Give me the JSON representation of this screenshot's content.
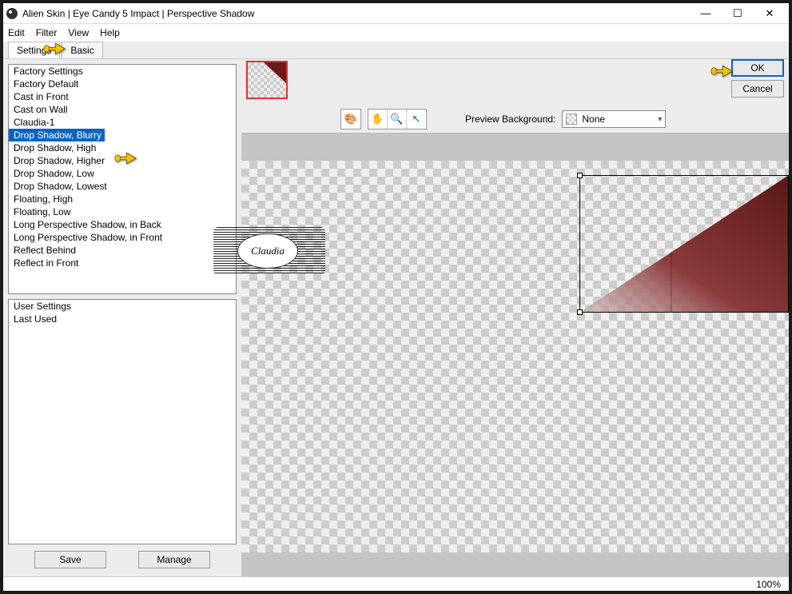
{
  "titlebar": {
    "title": "Alien Skin | Eye Candy 5 Impact | Perspective Shadow"
  },
  "menu": {
    "edit": "Edit",
    "filter": "Filter",
    "view": "View",
    "help": "Help"
  },
  "tabs": {
    "settings": "Settings",
    "basic": "Basic"
  },
  "factory_list": {
    "header": "Factory Settings",
    "items": [
      "Factory Default",
      "Cast in Front",
      "Cast on Wall",
      "Claudia-1",
      "Drop Shadow, Blurry",
      "Drop Shadow, High",
      "Drop Shadow, Higher",
      "Drop Shadow, Low",
      "Drop Shadow, Lowest",
      "Floating, High",
      "Floating, Low",
      "Long Perspective Shadow, in Back",
      "Long Perspective Shadow, in Front",
      "Reflect Behind",
      "Reflect in Front"
    ],
    "selected_index": 4
  },
  "user_list": {
    "header": "User Settings",
    "items": [
      "Last Used"
    ]
  },
  "buttons": {
    "save": "Save",
    "manage": "Manage",
    "ok": "OK",
    "cancel": "Cancel"
  },
  "preview": {
    "label": "Preview Background:",
    "selected": "None"
  },
  "status": {
    "zoom": "100%"
  },
  "stamp": {
    "text": "Claudia"
  }
}
